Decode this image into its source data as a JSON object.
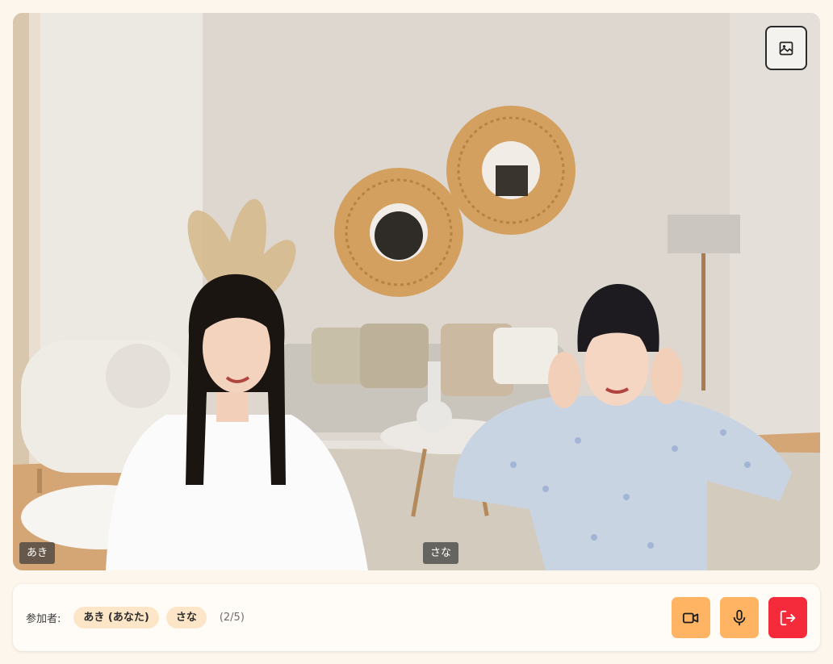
{
  "participants_label": "参加者:",
  "participants": [
    {
      "chip": "あき (あなた)",
      "tag": "あき"
    },
    {
      "chip": "さな",
      "tag": "さな"
    }
  ],
  "participant_count": "(2/5)",
  "icons": {
    "background": "image-icon",
    "camera": "video-camera-icon",
    "mic": "microphone-icon",
    "leave": "exit-icon"
  },
  "colors": {
    "page_bg": "#fdf6ec",
    "chip_bg": "#fde6c8",
    "control_accent": "#ffb463",
    "leave_button": "#f52a3a"
  }
}
